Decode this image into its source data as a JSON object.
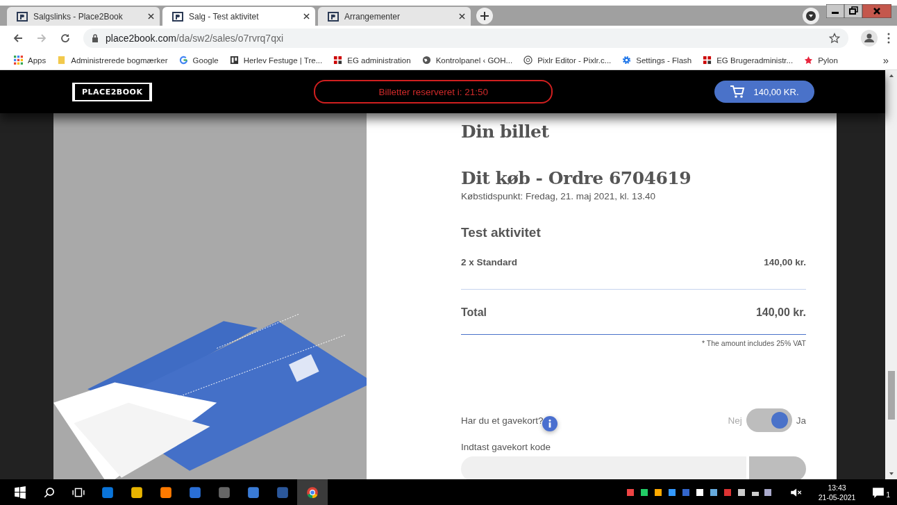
{
  "browser": {
    "tabs": [
      {
        "title": "Salgslinks - Place2Book",
        "selected": false
      },
      {
        "title": "Salg - Test aktivitet",
        "selected": true
      },
      {
        "title": "Arrangementer",
        "selected": false
      }
    ],
    "url_host": "place2book.com",
    "url_path": "/da/sw2/sales/o7rvrq7qxi",
    "bookmarks": [
      {
        "label": "Apps",
        "kind": "apps"
      },
      {
        "label": "Administrerede bogmærker",
        "kind": "folder"
      },
      {
        "label": "Google",
        "kind": "google"
      },
      {
        "label": "Herlev Festuge | Tre...",
        "kind": "board"
      },
      {
        "label": "EG administration",
        "kind": "eg"
      },
      {
        "label": "Kontrolpanel ‹ GOH...",
        "kind": "globe"
      },
      {
        "label": "Pixlr Editor - Pixlr.c...",
        "kind": "aperture"
      },
      {
        "label": "Settings - Flash",
        "kind": "gear"
      },
      {
        "label": "EG Brugeradministr...",
        "kind": "eg"
      },
      {
        "label": "Pylon",
        "kind": "pylon"
      }
    ],
    "bookmarks_more": "»"
  },
  "header": {
    "logo": "PLACE2BOOK",
    "timer": "Billetter reserveret i: 21:50",
    "cart_total": "140,00 KR."
  },
  "order": {
    "heading": "Din billet",
    "title": "Dit køb - Ordre 6704619",
    "purchase_time": "Købstidspunkt: Fredag, 21. maj 2021, kl. 13.40",
    "event": "Test aktivitet",
    "lines": [
      {
        "label": "2 x Standard",
        "amount": "140,00 kr."
      }
    ],
    "total_label": "Total",
    "total_amount": "140,00 kr.",
    "vat_note": "* The amount includes 25% VAT"
  },
  "gift_card": {
    "question": "Har du et gavekort?",
    "off_label": "Nej",
    "on_label": "Ja",
    "on": true,
    "code_label": "Indtast gavekort kode"
  },
  "taskbar": {
    "time": "13:43",
    "date": "21-05-2021",
    "notifications": "1"
  }
}
